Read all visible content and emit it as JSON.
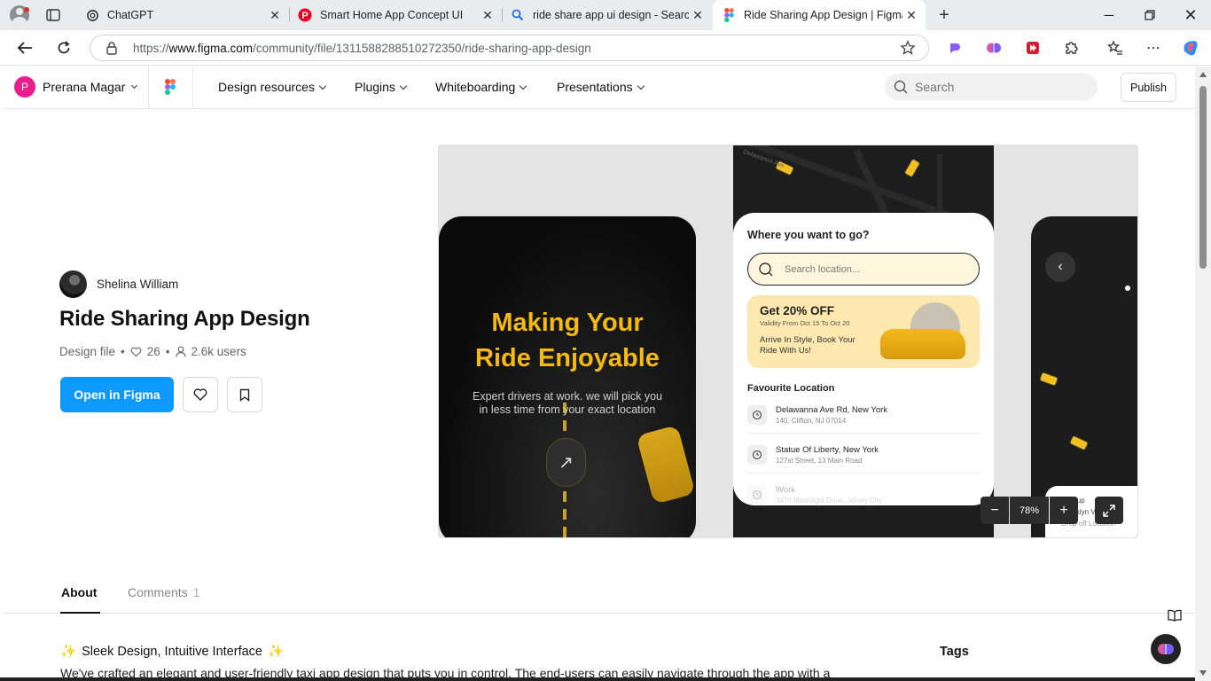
{
  "browser": {
    "tabs": [
      {
        "label": "ChatGPT",
        "icon": "chatgpt-icon"
      },
      {
        "label": "Smart Home App Concept UI",
        "icon": "pinterest-icon"
      },
      {
        "label": "ride share app ui design - Search",
        "icon": "search-icon"
      },
      {
        "label": "Ride Sharing App Design | Figma",
        "icon": "figma-icon",
        "active": true
      }
    ],
    "url_prefix": "https://",
    "url_host": "www.figma.com",
    "url_path": "/community/file/1311588288510272350/ride-sharing-app-design"
  },
  "nav": {
    "user_initial": "P",
    "user_name": "Prerana Magar",
    "menu": [
      "Design resources",
      "Plugins",
      "Whiteboarding",
      "Presentations"
    ],
    "search_placeholder": "Search",
    "publish_label": "Publish"
  },
  "file": {
    "author": "Shelina William",
    "title": "Ride Sharing App Design",
    "type": "Design file",
    "likes": "26",
    "users": "2.6k users",
    "open_label": "Open in Figma"
  },
  "preview": {
    "headline_line1": "Making Your",
    "headline_line2": "Ride Enjoyable",
    "subtext_line1": "Expert drivers at work. we will pick you",
    "subtext_line2": "in less time from your exact location",
    "question": "Where you want to go?",
    "search_placeholder": "Search location...",
    "promo_title": "Get 20% OFF",
    "promo_validity": "Validity From Oct 15 To Oct 20",
    "promo_desc": "Arrive In Style, Book Your Ride With Us!",
    "fav_heading": "Favourite Location",
    "locations": [
      {
        "name": "Delawanna Ave Rd, New York",
        "addr": "140, Clifton, NJ 07014"
      },
      {
        "name": "Statue Of Liberty, New York",
        "addr": "127st  Street, 13 Main Road"
      },
      {
        "name": "Work",
        "addr": "3470 Moonlight Drive, Jersey City"
      }
    ],
    "map_label": "Delawanna Ave",
    "right_sheet_line1": "Pick-up",
    "right_sheet_line2": "Brooklyn View",
    "right_sheet_line3": "Drop-off Location",
    "zoom": "78%"
  },
  "tabs": {
    "about": "About",
    "comments": "Comments",
    "comments_count": "1"
  },
  "about": {
    "heading": "Sleek Design, Intuitive Interface",
    "paragraph": "We've crafted an elegant and user-friendly taxi app design that puts you in control. The end-users can easily navigate through the app with a",
    "tags_heading": "Tags"
  },
  "colors": {
    "figma_blue": "#0d99ff",
    "accent_yellow": "#f5b912",
    "avatar_pink": "#e91e8c"
  }
}
